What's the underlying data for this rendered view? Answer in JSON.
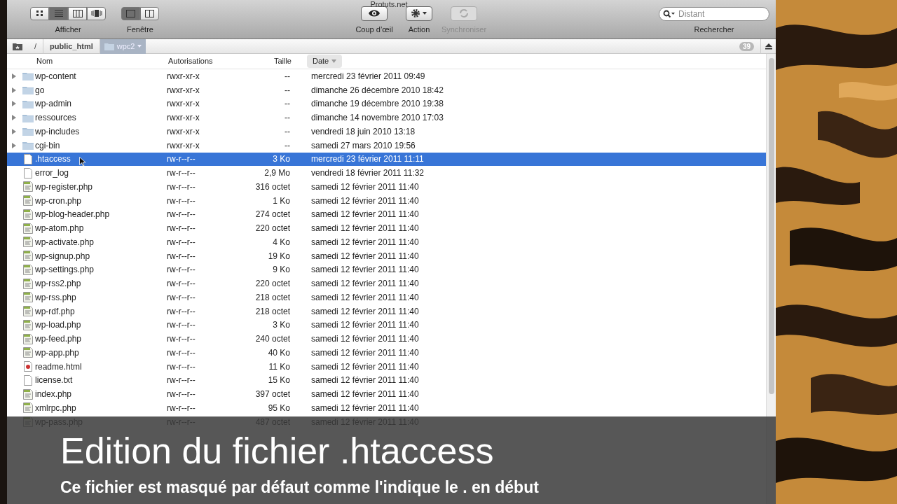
{
  "window": {
    "title": "Protuts.net"
  },
  "toolbar": {
    "view_buttons": [
      {
        "selected": false
      },
      {
        "selected": true
      },
      {
        "selected": false
      },
      {
        "selected": false
      }
    ],
    "view_label": "Afficher",
    "window_buttons": [
      {
        "selected": true
      },
      {
        "selected": false
      }
    ],
    "window_label": "Fenêtre",
    "actions": [
      {
        "kind": "eye",
        "label": "Coup d’œil",
        "disabled": false
      },
      {
        "kind": "gear",
        "label": "Action",
        "disabled": false
      },
      {
        "kind": "sync",
        "label": "Synchroniser",
        "disabled": true
      }
    ],
    "search": {
      "placeholder": "Distant",
      "label": "Rechercher"
    }
  },
  "path_bar": {
    "crumbs": [
      "/",
      "public_html",
      "wpc2"
    ],
    "count": "39"
  },
  "table": {
    "columns": [
      "Nom",
      "Autorisations",
      "Taille",
      "Date"
    ],
    "rows": [
      {
        "kind": "folder",
        "name": "wp-content",
        "perm": "rwxr-xr-x",
        "size": "--",
        "date": "mercredi 23 février 2011 09:49",
        "selected": false
      },
      {
        "kind": "folder",
        "name": "go",
        "perm": "rwxr-xr-x",
        "size": "--",
        "date": "dimanche 26 décembre 2010 18:42",
        "selected": false
      },
      {
        "kind": "folder",
        "name": "wp-admin",
        "perm": "rwxr-xr-x",
        "size": "--",
        "date": "dimanche 19 décembre 2010 19:38",
        "selected": false
      },
      {
        "kind": "folder",
        "name": "ressources",
        "perm": "rwxr-xr-x",
        "size": "--",
        "date": "dimanche 14 novembre 2010 17:03",
        "selected": false
      },
      {
        "kind": "folder",
        "name": "wp-includes",
        "perm": "rwxr-xr-x",
        "size": "--",
        "date": "vendredi 18 juin 2010 13:18",
        "selected": false
      },
      {
        "kind": "folder",
        "name": "cgi-bin",
        "perm": "rwxr-xr-x",
        "size": "--",
        "date": "samedi 27 mars 2010 19:56",
        "selected": false
      },
      {
        "kind": "file",
        "name": ".htaccess",
        "perm": "rw-r--r--",
        "size": "3 Ko",
        "date": "mercredi 23 février 2011 11:11",
        "selected": true
      },
      {
        "kind": "file",
        "name": "error_log",
        "perm": "rw-r--r--",
        "size": "2,9 Mo",
        "date": "vendredi 18 février 2011 11:32",
        "selected": false
      },
      {
        "kind": "php",
        "name": "wp-register.php",
        "perm": "rw-r--r--",
        "size": "316 octet",
        "date": "samedi 12 février 2011 11:40",
        "selected": false
      },
      {
        "kind": "php",
        "name": "wp-cron.php",
        "perm": "rw-r--r--",
        "size": "1 Ko",
        "date": "samedi 12 février 2011 11:40",
        "selected": false
      },
      {
        "kind": "php",
        "name": "wp-blog-header.php",
        "perm": "rw-r--r--",
        "size": "274 octet",
        "date": "samedi 12 février 2011 11:40",
        "selected": false
      },
      {
        "kind": "php",
        "name": "wp-atom.php",
        "perm": "rw-r--r--",
        "size": "220 octet",
        "date": "samedi 12 février 2011 11:40",
        "selected": false
      },
      {
        "kind": "php",
        "name": "wp-activate.php",
        "perm": "rw-r--r--",
        "size": "4 Ko",
        "date": "samedi 12 février 2011 11:40",
        "selected": false
      },
      {
        "kind": "php",
        "name": "wp-signup.php",
        "perm": "rw-r--r--",
        "size": "19 Ko",
        "date": "samedi 12 février 2011 11:40",
        "selected": false
      },
      {
        "kind": "php",
        "name": "wp-settings.php",
        "perm": "rw-r--r--",
        "size": "9 Ko",
        "date": "samedi 12 février 2011 11:40",
        "selected": false
      },
      {
        "kind": "php",
        "name": "wp-rss2.php",
        "perm": "rw-r--r--",
        "size": "220 octet",
        "date": "samedi 12 février 2011 11:40",
        "selected": false
      },
      {
        "kind": "php",
        "name": "wp-rss.php",
        "perm": "rw-r--r--",
        "size": "218 octet",
        "date": "samedi 12 février 2011 11:40",
        "selected": false
      },
      {
        "kind": "php",
        "name": "wp-rdf.php",
        "perm": "rw-r--r--",
        "size": "218 octet",
        "date": "samedi 12 février 2011 11:40",
        "selected": false
      },
      {
        "kind": "php",
        "name": "wp-load.php",
        "perm": "rw-r--r--",
        "size": "3 Ko",
        "date": "samedi 12 février 2011 11:40",
        "selected": false
      },
      {
        "kind": "php",
        "name": "wp-feed.php",
        "perm": "rw-r--r--",
        "size": "240 octet",
        "date": "samedi 12 février 2011 11:40",
        "selected": false
      },
      {
        "kind": "php",
        "name": "wp-app.php",
        "perm": "rw-r--r--",
        "size": "40 Ko",
        "date": "samedi 12 février 2011 11:40",
        "selected": false
      },
      {
        "kind": "html",
        "name": "readme.html",
        "perm": "rw-r--r--",
        "size": "11 Ko",
        "date": "samedi 12 février 2011 11:40",
        "selected": false
      },
      {
        "kind": "file",
        "name": "license.txt",
        "perm": "rw-r--r--",
        "size": "15 Ko",
        "date": "samedi 12 février 2011 11:40",
        "selected": false
      },
      {
        "kind": "php",
        "name": "index.php",
        "perm": "rw-r--r--",
        "size": "397 octet",
        "date": "samedi 12 février 2011 11:40",
        "selected": false
      },
      {
        "kind": "php",
        "name": "xmlrpc.php",
        "perm": "rw-r--r--",
        "size": "95 Ko",
        "date": "samedi 12 février 2011 11:40",
        "selected": false
      },
      {
        "kind": "php",
        "name": "wp-pass.php",
        "perm": "rw-r--r--",
        "size": "487 octet",
        "date": "samedi 12 février 2011 11:40",
        "selected": false
      }
    ]
  },
  "caption": {
    "title": "Edition du fichier .htaccess",
    "subtitle": "Ce fichier est masqué par défaut comme l'indique le . en début"
  }
}
